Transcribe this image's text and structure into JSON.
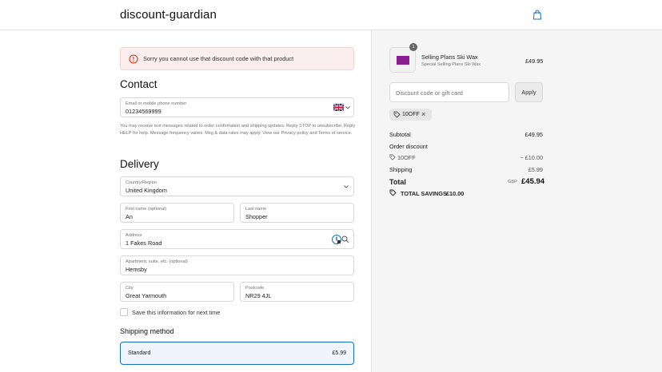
{
  "header": {
    "logo": "discount-guardian",
    "cart_icon": "shopping-bag-icon"
  },
  "error": {
    "message": "Sorry you cannot use that discount code with that product",
    "icon": "alert-circle-icon",
    "color": "#d72c0d"
  },
  "contact": {
    "title": "Contact",
    "phone_label": "Email or mobile phone number",
    "phone_value": "01234569999",
    "country_flag": "uk-flag-icon",
    "disclaimer": "You may receive text messages related to order confirmation and shipping updates. Reply STOP to unsubscribe. Reply HELP for help. Message frequency varies. Msg & data rates may apply. View our Privacy policy and Terms of service."
  },
  "delivery": {
    "title": "Delivery",
    "country_label": "Country/Region",
    "country_value": "United Kingdom",
    "first_name_label": "First name (optional)",
    "first_name_value": "An",
    "last_name_label": "Last name",
    "last_name_value": "Shopper",
    "address_label": "Address",
    "address_value": "1 Fakes Road",
    "apartment_label": "Apartment, suite, etc. (optional)",
    "apartment_value": "Hemsby",
    "city_label": "City",
    "city_value": "Great Yarmouth",
    "postcode_label": "Postcode",
    "postcode_value": "NR29 4JL",
    "save_info_label": "Save this information for next time"
  },
  "shipping": {
    "title": "Shipping method",
    "option_name": "Standard",
    "option_price": "£5.99",
    "accent": "#1773b0"
  },
  "summary": {
    "item": {
      "quantity": "1",
      "name": "Selling Plans Ski Wax",
      "variant": "Special Selling Plans Ski Wax",
      "price": "£49.95"
    },
    "discount_placeholder": "Discount code or gift card",
    "apply_label": "Apply",
    "applied_code": "10OFF",
    "subtotal_label": "Subtotal",
    "subtotal_value": "£49.95",
    "order_discount_label": "Order discount",
    "discount_code_label": "10OFF",
    "discount_value": "− £10.00",
    "shipping_label": "Shipping",
    "shipping_value": "£5.99",
    "total_label": "Total",
    "total_currency": "GBP",
    "total_value": "£45.94",
    "savings_label": "TOTAL SAVINGS",
    "savings_value": "£10.00"
  }
}
